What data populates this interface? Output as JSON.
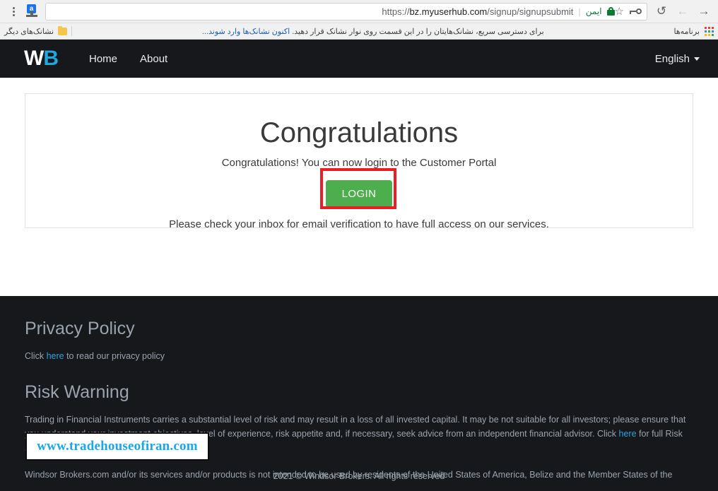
{
  "browser": {
    "menu_icon": "kebab-menu-icon",
    "extension_icon": "extension-icon",
    "extension_badge": "a",
    "bookmark_star_icon": "star-icon",
    "password_key_icon": "key-icon",
    "url_scheme": "https://",
    "url_host": "bz.myuserhub.com",
    "url_path": "/signup/signupsubmit",
    "url_full": "https://bz.myuserhub.com/signup/signupsubmit",
    "secure_label": "ایمن",
    "lock_icon": "lock-icon",
    "reload_icon": "↺",
    "back_icon": "←",
    "forward_icon": "→",
    "bookmarks": {
      "apps_label": "برنامه‌ها",
      "apps_grid_icon": "apps-grid-icon",
      "hint_text": "برای دسترسی سریع، نشانک‌هایتان را در این قسمت روی نوار نشانک قرار دهید.",
      "hint_link": "اکنون نشانک‌ها وارد شوند...",
      "other_bookmarks_label": "نشانک‌های دیگر",
      "folder_icon": "folder-icon"
    }
  },
  "site_nav": {
    "logo_first": "W",
    "logo_second": "B",
    "links": [
      {
        "label": "Home"
      },
      {
        "label": "About"
      }
    ],
    "language": "English",
    "caret_icon": "chevron-down-icon"
  },
  "card": {
    "title": "Congratulations",
    "subtitle": "Congratulations! You can now login to the Customer Portal",
    "login_label": "LOGIN",
    "note": "Please check your inbox for email verification to have full access on our services."
  },
  "footer": {
    "privacy_heading": "Privacy Policy",
    "privacy_text_before": "Click ",
    "privacy_link": "here",
    "privacy_text_after": " to read our privacy policy",
    "risk_heading": "Risk Warning",
    "risk_text_before": "Trading in Financial Instruments carries a substantial level of risk and may result in a loss of all invested capital. It may be not suitable for all investors; please ensure that you understand your investment objectives, level of experience, risk appetite and, if necessary, seek advice from an independent financial advisor. Click ",
    "risk_link": "here",
    "risk_text_after": " for full Risk Statement.",
    "restriction_text": "Windsor Brokers.com and/or its services and/or products is not intended to be used by residents of the United States of America, Belize and the Member States of the",
    "copyright": "2021 © Windsor Brokers. All rights reserved"
  },
  "overlay": {
    "watermark_text": "www.tradehouseofiran.com",
    "highlight_color": "#ec1c24"
  }
}
